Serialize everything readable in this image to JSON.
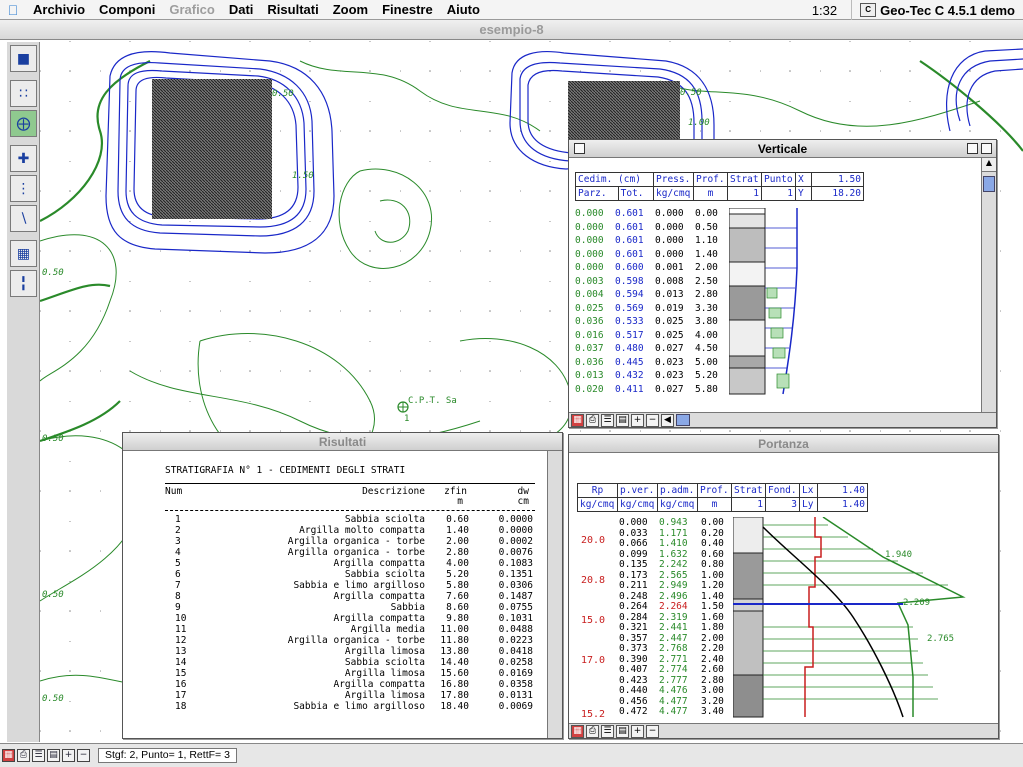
{
  "menubar": {
    "items": [
      "Archivio",
      "Componi",
      "Grafico",
      "Dati",
      "Risultati",
      "Zoom",
      "Finestre",
      "Aiuto"
    ],
    "disabled_index": 2,
    "clock": "1:32",
    "app_name": "Geo-Tec C 4.5.1 demo",
    "app_icon_label": "C"
  },
  "main_window": {
    "title": "esempio-8"
  },
  "map": {
    "cpt_label": "C.P.T. Sa",
    "cpt_id": "1",
    "contour_labels": [
      "0.50",
      "1.50",
      "0.50",
      "0.50",
      "0.50",
      "0.50"
    ],
    "top_right_labels": [
      "0.50",
      "1.00"
    ]
  },
  "verticale": {
    "title": "Verticale",
    "headers": [
      "Cedim. (cm)",
      "Press.",
      "Prof.",
      "Strat",
      "Punto",
      "X",
      "1.50"
    ],
    "subheaders": [
      "Parz.",
      "Tot.",
      "kg/cmq",
      "m",
      "1",
      "1",
      "Y",
      "18.20"
    ],
    "rows": [
      [
        "0.000",
        "0.601",
        "0.000",
        "0.00"
      ],
      [
        "0.000",
        "0.601",
        "0.000",
        "0.50"
      ],
      [
        "0.000",
        "0.601",
        "0.000",
        "1.10"
      ],
      [
        "0.000",
        "0.601",
        "0.000",
        "1.40"
      ],
      [
        "0.000",
        "0.600",
        "0.001",
        "2.00"
      ],
      [
        "0.003",
        "0.598",
        "0.008",
        "2.50"
      ],
      [
        "0.004",
        "0.594",
        "0.013",
        "2.80"
      ],
      [
        "0.025",
        "0.569",
        "0.019",
        "3.30"
      ],
      [
        "0.036",
        "0.533",
        "0.025",
        "3.80"
      ],
      [
        "0.016",
        "0.517",
        "0.025",
        "4.00"
      ],
      [
        "0.037",
        "0.480",
        "0.027",
        "4.50"
      ],
      [
        "0.036",
        "0.445",
        "0.023",
        "5.00"
      ],
      [
        "0.013",
        "0.432",
        "0.023",
        "5.20"
      ],
      [
        "0.020",
        "0.411",
        "0.027",
        "5.80"
      ]
    ]
  },
  "risultati": {
    "title": "Risultati",
    "heading": "STRATIGRAFIA N° 1 - CEDIMENTI DEGLI STRATI",
    "col_num": "Num",
    "col_desc": "Descrizione",
    "col_zfin": "zfin",
    "col_zfin_unit": "m",
    "col_dw": "dw",
    "col_dw_unit": "cm",
    "rows": [
      [
        "1",
        "Sabbia sciolta",
        "0.60",
        "0.0000"
      ],
      [
        "2",
        "Argilla molto compatta",
        "1.40",
        "0.0000"
      ],
      [
        "3",
        "Argilla organica - torbe",
        "2.00",
        "0.0002"
      ],
      [
        "4",
        "Argilla organica - torbe",
        "2.80",
        "0.0076"
      ],
      [
        "5",
        "Argilla compatta",
        "4.00",
        "0.1083"
      ],
      [
        "6",
        "Sabbia sciolta",
        "5.20",
        "0.1351"
      ],
      [
        "7",
        "Sabbia e limo argilloso",
        "5.80",
        "0.0306"
      ],
      [
        "8",
        "Argilla compatta",
        "7.60",
        "0.1487"
      ],
      [
        "9",
        "Sabbia",
        "8.60",
        "0.0755"
      ],
      [
        "10",
        "Argilla compatta",
        "9.80",
        "0.1031"
      ],
      [
        "11",
        "Argilla media",
        "11.00",
        "0.0488"
      ],
      [
        "12",
        "Argilla organica - torbe",
        "11.80",
        "0.0223"
      ],
      [
        "13",
        "Argilla limosa",
        "13.80",
        "0.0418"
      ],
      [
        "14",
        "Sabbia sciolta",
        "14.40",
        "0.0258"
      ],
      [
        "15",
        "Argilla limosa",
        "15.60",
        "0.0169"
      ],
      [
        "16",
        "Argilla compatta",
        "16.80",
        "0.0358"
      ],
      [
        "17",
        "Argilla limosa",
        "17.80",
        "0.0131"
      ],
      [
        "18",
        "Sabbia e limo argilloso",
        "18.40",
        "0.0069"
      ]
    ]
  },
  "portanza": {
    "title": "Portanza",
    "headers": [
      "Rp",
      "p.ver.",
      "p.adm.",
      "Prof.",
      "Strat",
      "Fond.",
      "Lx",
      "1.40"
    ],
    "subheaders": [
      "kg/cmq",
      "kg/cmq",
      "kg/cmq",
      "m",
      "1",
      "3",
      "Ly",
      "1.40"
    ],
    "rp_labels": [
      "20.0",
      "20.8",
      "15.0",
      "17.0",
      "15.2"
    ],
    "rows": [
      [
        "0.000",
        "0.943",
        "0.00"
      ],
      [
        "0.033",
        "1.171",
        "0.20"
      ],
      [
        "0.066",
        "1.410",
        "0.40"
      ],
      [
        "0.099",
        "1.632",
        "0.60"
      ],
      [
        "0.135",
        "2.242",
        "0.80"
      ],
      [
        "0.173",
        "2.565",
        "1.00"
      ],
      [
        "0.211",
        "2.949",
        "1.20"
      ],
      [
        "0.248",
        "2.496",
        "1.40"
      ],
      [
        "0.264",
        "2.264",
        "1.50"
      ],
      [
        "0.284",
        "2.319",
        "1.60"
      ],
      [
        "0.321",
        "2.441",
        "1.80"
      ],
      [
        "0.357",
        "2.447",
        "2.00"
      ],
      [
        "0.373",
        "2.768",
        "2.20"
      ],
      [
        "0.390",
        "2.771",
        "2.40"
      ],
      [
        "0.407",
        "2.774",
        "2.60"
      ],
      [
        "0.423",
        "2.777",
        "2.80"
      ],
      [
        "0.440",
        "4.476",
        "3.00"
      ],
      [
        "0.456",
        "4.477",
        "3.20"
      ],
      [
        "0.472",
        "4.477",
        "3.40"
      ]
    ],
    "highlight_row": 8,
    "curve_labels": [
      "1.940",
      "2.209",
      "2.765"
    ]
  },
  "status": {
    "text": "Stgf: 2, Punto= 1, RettF= 3"
  },
  "colors": {
    "contour_blue": "#1a28c8",
    "contour_green": "#2a8a2a",
    "data_blue": "#1a28c8",
    "data_green": "#2a8a2a",
    "highlight_red": "#c81e1e"
  }
}
